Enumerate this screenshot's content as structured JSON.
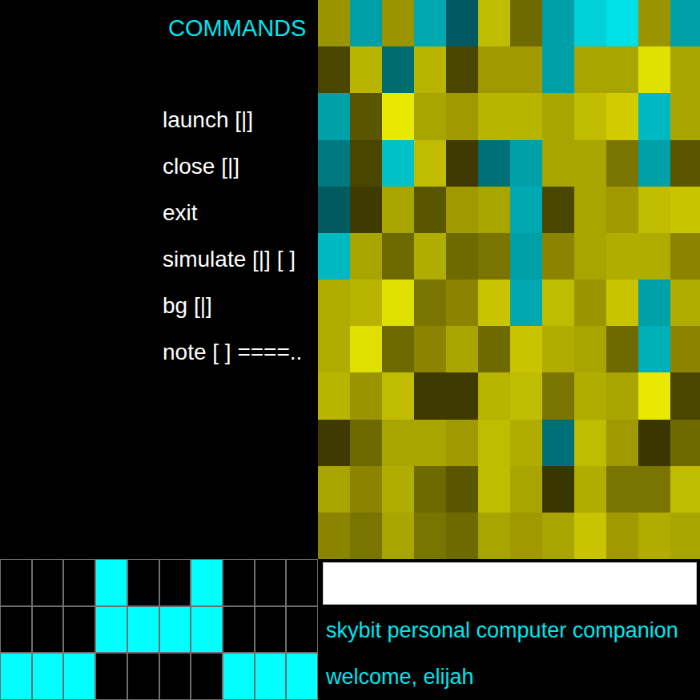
{
  "commands": {
    "title": "COMMANDS",
    "items": [
      "launch [|]",
      "close [|]",
      "exit",
      "simulate [|] [ ]",
      "bg [|]",
      "note [ ] ====.."
    ]
  },
  "color_grid": {
    "rows": [
      [
        "#9a9400",
        "#00a0a8",
        "#9a9400",
        "#00a8b0",
        "#005860",
        "#c0bc00",
        "#6e6a00",
        "#00a0a8",
        "#00d0d8",
        "#00e0e8",
        "#9a9400",
        "#00a0a8"
      ],
      [
        "#4a4600",
        "#b8b400",
        "#006c70",
        "#b8b400",
        "#4a4600",
        "#a09a00",
        "#a09a00",
        "#00a0a8",
        "#a8a400",
        "#a8a400",
        "#e0e000",
        "#a8a400"
      ],
      [
        "#00a0a8",
        "#5a5600",
        "#e8e800",
        "#a8a400",
        "#a09a00",
        "#b8b400",
        "#b8b400",
        "#a8a400",
        "#c0bc00",
        "#d0cc00",
        "#00b8c0",
        "#a8a400"
      ],
      [
        "#007880",
        "#4a4600",
        "#00c0c8",
        "#c0bc00",
        "#3e3a00",
        "#007078",
        "#00a0a8",
        "#a8a400",
        "#a8a400",
        "#7a7400",
        "#00a0a8",
        "#5a5600"
      ],
      [
        "#005a60",
        "#3e3a00",
        "#a8a400",
        "#5a5600",
        "#a09a00",
        "#a8a400",
        "#00a8b0",
        "#4a4600",
        "#a8a400",
        "#a09a00",
        "#c0bc00",
        "#c8c400"
      ],
      [
        "#00b8c0",
        "#a8a400",
        "#6e6a00",
        "#b0ac00",
        "#6e6a00",
        "#7a7400",
        "#00a0a8",
        "#8a8400",
        "#a8a400",
        "#b0ac00",
        "#b0ac00",
        "#8a8400"
      ],
      [
        "#b0ac00",
        "#b8b400",
        "#e0e000",
        "#7a7400",
        "#8a8400",
        "#c8c400",
        "#00a8b0",
        "#c0bc00",
        "#9a9400",
        "#c8c400",
        "#00a0a8",
        "#b0ac00"
      ],
      [
        "#b0ac00",
        "#e0e000",
        "#6e6a00",
        "#8a8400",
        "#a8a400",
        "#6e6a00",
        "#c8c400",
        "#b0ac00",
        "#a8a400",
        "#6e6a00",
        "#00b0b8",
        "#8a8400"
      ],
      [
        "#b8b400",
        "#9a9400",
        "#c0bc00",
        "#3e3a00",
        "#3e3a00",
        "#b8b400",
        "#c0bc00",
        "#7a7400",
        "#b0ac00",
        "#a8a400",
        "#e8e800",
        "#4a4600"
      ],
      [
        "#3e3a00",
        "#6e6a00",
        "#a8a400",
        "#a8a400",
        "#a09a00",
        "#c0bc00",
        "#b0ac00",
        "#007078",
        "#c0bc00",
        "#a09a00",
        "#3a3600",
        "#6e6a00"
      ],
      [
        "#a8a400",
        "#8a8400",
        "#b0ac00",
        "#6e6a00",
        "#5a5600",
        "#c0bc00",
        "#a8a400",
        "#3a3600",
        "#b0ac00",
        "#7a7400",
        "#7a7400",
        "#c0bc00"
      ],
      [
        "#8a8400",
        "#7a7400",
        "#a8a400",
        "#7a7400",
        "#6e6a00",
        "#a8a400",
        "#a09a00",
        "#a8a400",
        "#c8c400",
        "#a09a00",
        "#b0ac00",
        "#a8a400"
      ]
    ]
  },
  "pattern_grid": {
    "rows": [
      [
        {
          "on": false
        },
        {
          "on": false
        },
        {
          "on": false
        },
        {
          "on": true
        },
        {
          "on": false
        },
        {
          "on": false
        },
        {
          "on": true
        },
        {
          "on": false
        },
        {
          "on": false
        },
        {
          "on": false
        }
      ],
      [
        {
          "on": false
        },
        {
          "on": false
        },
        {
          "on": false
        },
        {
          "on": true
        },
        {
          "on": true
        },
        {
          "on": true
        },
        {
          "on": true
        },
        {
          "on": false
        },
        {
          "on": false
        },
        {
          "on": false
        }
      ],
      [
        {
          "on": true
        },
        {
          "on": true
        },
        {
          "on": true
        },
        {
          "on": false
        },
        {
          "on": false
        },
        {
          "on": false
        },
        {
          "on": false
        },
        {
          "on": true
        },
        {
          "on": true
        },
        {
          "on": true
        }
      ]
    ]
  },
  "input": {
    "value": ""
  },
  "status": {
    "title": "skybit personal computer companion",
    "greeting": "welcome, elijah"
  }
}
